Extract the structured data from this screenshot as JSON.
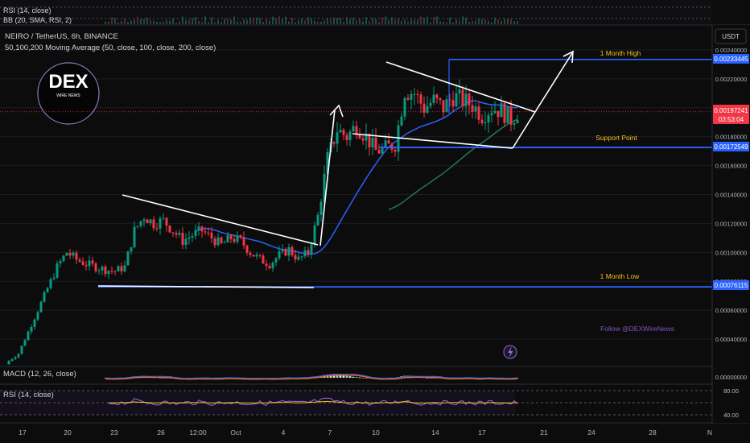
{
  "header": {
    "symbol_line": "NEIRO / TetherUS, 6h, BINANCE",
    "ma_line": "50,100,200 Moving Average (50, close, 100, close, 200, close)",
    "top_rsi": "RSI (14, close)",
    "top_bb": "BB (20, SMA, RSI, 2)"
  },
  "currency_button": "USDT",
  "logo": {
    "text": "DEX",
    "sub": "WIRE NEWS"
  },
  "annotations": {
    "month_high": "1 Month High",
    "support": "Support Point",
    "month_low": "1 Month Low",
    "follow": "Follow @DEXWireNews"
  },
  "price_axis": {
    "ticks": [
      "0.00240000",
      "0.00220000",
      "0.00200000",
      "0.00180000",
      "0.00160000",
      "0.00140000",
      "0.00120000",
      "0.00100000",
      "0.00080000",
      "0.00060000",
      "0.00040000"
    ],
    "high_label": "0.00233445",
    "current_label": "0.00197241",
    "countdown": "03:53:04",
    "support_label": "0.00172549",
    "low_label": "0.00076115"
  },
  "macd": {
    "label": "MACD (12, 26, close)",
    "axis": "0.00000000"
  },
  "rsi": {
    "label": "RSI (14, close)",
    "axis_top": "80.00",
    "axis_bottom": "40.00"
  },
  "time_axis": [
    "17",
    "20",
    "23",
    "26",
    "12:00",
    "Oct",
    "4",
    "7",
    "10",
    "14",
    "17",
    "21",
    "24",
    "28",
    "N"
  ],
  "colors": {
    "bg": "#0c0c0c",
    "up": "#089981",
    "down": "#f23645",
    "level": "#2962ff",
    "ma_blue": "#2962ff",
    "ma_green": "#1e7a52",
    "trend": "#ffffff",
    "gold": "#f0c419",
    "rsi_line": "#9c6fe0"
  },
  "chart_data": {
    "type": "candlestick",
    "pair": "NEIRO / TetherUS",
    "interval": "6h",
    "levels": {
      "month_high": 0.00233445,
      "support": 0.00172549,
      "month_low": 0.00076115,
      "current": 0.00197241
    },
    "close_path": [
      [
        0,
        0.00025
      ],
      [
        3,
        0.0003
      ],
      [
        6,
        0.00045
      ],
      [
        9,
        0.0006
      ],
      [
        12,
        0.00075
      ],
      [
        15,
        0.0009
      ],
      [
        18,
        0.001
      ],
      [
        21,
        0.00095
      ],
      [
        24,
        0.00092
      ],
      [
        27,
        0.0009
      ],
      [
        30,
        0.00088
      ],
      [
        33,
        0.00087
      ],
      [
        36,
        0.0009
      ],
      [
        39,
        0.00115
      ],
      [
        42,
        0.00125
      ],
      [
        45,
        0.0012
      ],
      [
        48,
        0.00122
      ],
      [
        51,
        0.00115
      ],
      [
        54,
        0.00108
      ],
      [
        57,
        0.00112
      ],
      [
        60,
        0.00115
      ],
      [
        63,
        0.0011
      ],
      [
        66,
        0.00105
      ],
      [
        69,
        0.0011
      ],
      [
        72,
        0.00108
      ],
      [
        75,
        0.001
      ],
      [
        78,
        0.00095
      ],
      [
        81,
        0.00092
      ],
      [
        84,
        0.00098
      ],
      [
        87,
        0.00102
      ],
      [
        90,
        0.00095
      ],
      [
        93,
        0.001
      ],
      [
        96,
        0.00125
      ],
      [
        99,
        0.00165
      ],
      [
        102,
        0.00185
      ],
      [
        105,
        0.0018
      ],
      [
        108,
        0.00188
      ],
      [
        111,
        0.0018
      ],
      [
        114,
        0.0017
      ],
      [
        117,
        0.00172
      ],
      [
        120,
        0.00175
      ],
      [
        123,
        0.00212
      ],
      [
        126,
        0.0021
      ],
      [
        129,
        0.002
      ],
      [
        132,
        0.00205
      ],
      [
        135,
        0.002
      ],
      [
        138,
        0.00208
      ],
      [
        141,
        0.00205
      ],
      [
        144,
        0.00202
      ],
      [
        147,
        0.00195
      ],
      [
        150,
        0.002
      ],
      [
        153,
        0.00198
      ],
      [
        156,
        0.00192
      ],
      [
        158,
        0.00197
      ]
    ]
  }
}
